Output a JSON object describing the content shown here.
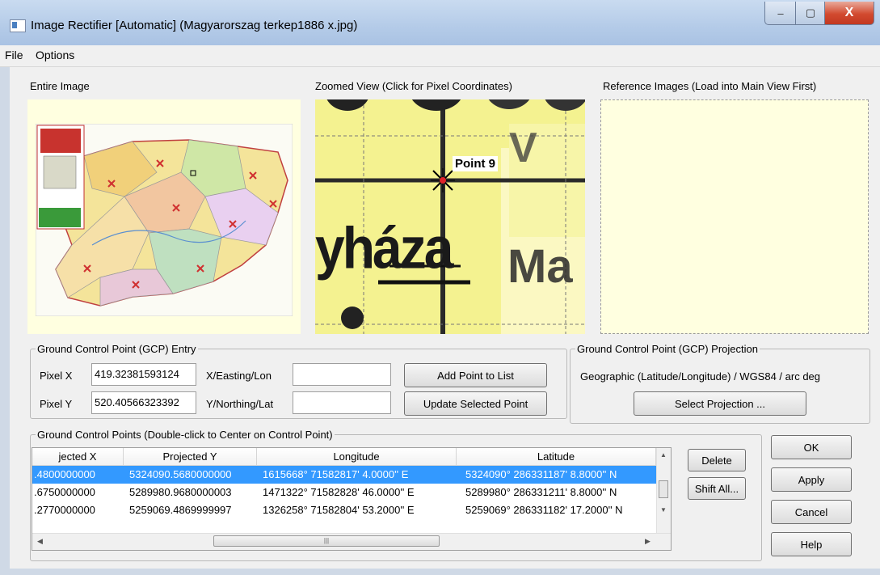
{
  "window": {
    "title": "Image Rectifier [Automatic] (Magyarorszag terkep1886 x.jpg)",
    "controls": {
      "minimize": "–",
      "maximize": "▢",
      "close": "X"
    }
  },
  "menu": [
    "File",
    "Options"
  ],
  "panels": {
    "entire_image_label": "Entire Image",
    "zoomed_view_label": "Zoomed View (Click for Pixel Coordinates)",
    "reference_label": "Reference Images (Load into Main View First)",
    "zoom_point_label": "Point 9",
    "zoom_text_big": "yháza",
    "zoom_text_right": "Ma"
  },
  "gcp_entry": {
    "legend": "Ground Control Point (GCP) Entry",
    "pixel_x_label": "Pixel X",
    "pixel_x_value": "419.32381593124",
    "pixel_y_label": "Pixel Y",
    "pixel_y_value": "520.40566323392",
    "easting_label": "X/Easting/Lon",
    "easting_value": "",
    "northing_label": "Y/Northing/Lat",
    "northing_value": "",
    "add_button": "Add Point to List",
    "update_button": "Update Selected Point"
  },
  "gcp_projection": {
    "legend": "Ground Control Point (GCP) Projection",
    "value": "Geographic (Latitude/Longitude) / WGS84 / arc deɡ",
    "select_button": "Select Projection ..."
  },
  "gcp_list": {
    "legend": "Ground Control Points (Double-click to Center on Control Point)",
    "columns": [
      "jected X",
      "Projected Y",
      "Longitude",
      "Latitude"
    ],
    "rows": [
      {
        "x": ".4800000000",
        "y": "5324090.5680000000",
        "lon": "1615668° 71582817' 4.0000'' E",
        "lat": "5324090° 286331187' 8.8000'' N",
        "selected": true
      },
      {
        "x": ".6750000000",
        "y": "5289980.9680000003",
        "lon": "1471322° 71582828' 46.0000'' E",
        "lat": "5289980° 286331211' 8.8000'' N",
        "selected": false
      },
      {
        "x": ".2770000000",
        "y": "5259069.4869999997",
        "lon": "1326258° 71582804' 53.2000'' E",
        "lat": "5259069° 286331182' 17.2000'' N",
        "selected": false
      }
    ],
    "delete_button": "Delete",
    "shift_all_button": "Shift All..."
  },
  "dialog_buttons": {
    "ok": "OK",
    "apply": "Apply",
    "cancel": "Cancel",
    "help": "Help"
  },
  "colors": {
    "panel_bg": "#ffffe0",
    "selection": "#3399ff",
    "window_frame": "#b4cbe8"
  }
}
